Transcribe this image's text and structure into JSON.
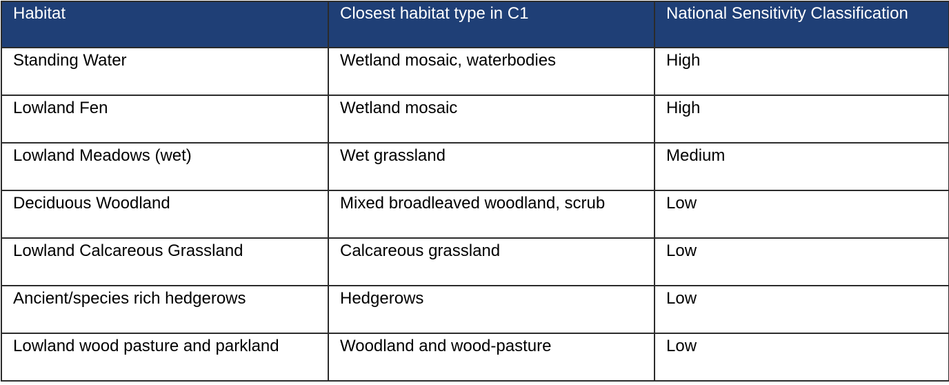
{
  "table": {
    "header_color": "#1f3f76",
    "headers": [
      "Habitat",
      "Closest habitat type in C1",
      "National Sensitivity Classification"
    ],
    "rows": [
      {
        "habitat": "Standing Water",
        "closest_type": "Wetland mosaic, waterbodies",
        "sensitivity": "High"
      },
      {
        "habitat": "Lowland Fen",
        "closest_type": "Wetland mosaic",
        "sensitivity": "High"
      },
      {
        "habitat": "Lowland Meadows (wet)",
        "closest_type": "Wet grassland",
        "sensitivity": "Medium"
      },
      {
        "habitat": "Deciduous Woodland",
        "closest_type": "Mixed broadleaved woodland, scrub",
        "sensitivity": "Low"
      },
      {
        "habitat": "Lowland Calcareous Grassland",
        "closest_type": "Calcareous grassland",
        "sensitivity": "Low"
      },
      {
        "habitat": "Ancient/species rich hedgerows",
        "closest_type": "Hedgerows",
        "sensitivity": "Low"
      },
      {
        "habitat": "Lowland wood pasture and parkland",
        "closest_type": "Woodland and wood-pasture",
        "sensitivity": "Low"
      }
    ]
  }
}
